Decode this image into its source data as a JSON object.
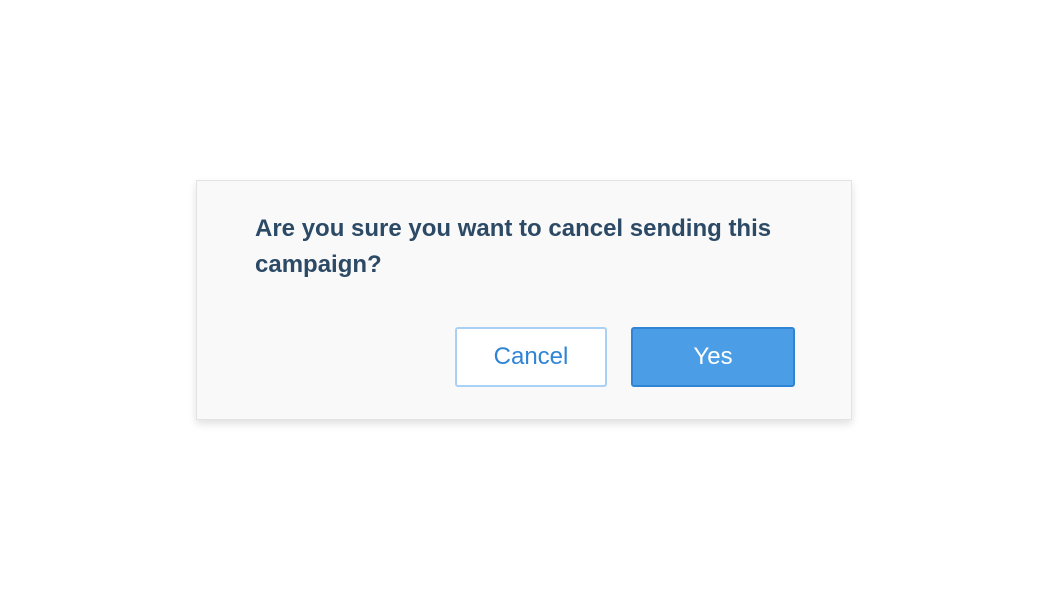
{
  "dialog": {
    "message": "Are you sure you want to cancel sending this campaign?",
    "cancel_label": "Cancel",
    "confirm_label": "Yes"
  },
  "colors": {
    "title_text": "#2c4a66",
    "primary": "#4b9ee6",
    "primary_border": "#2f84d6",
    "secondary_border": "#a9d0f5",
    "dialog_background": "#f9f9f9"
  }
}
